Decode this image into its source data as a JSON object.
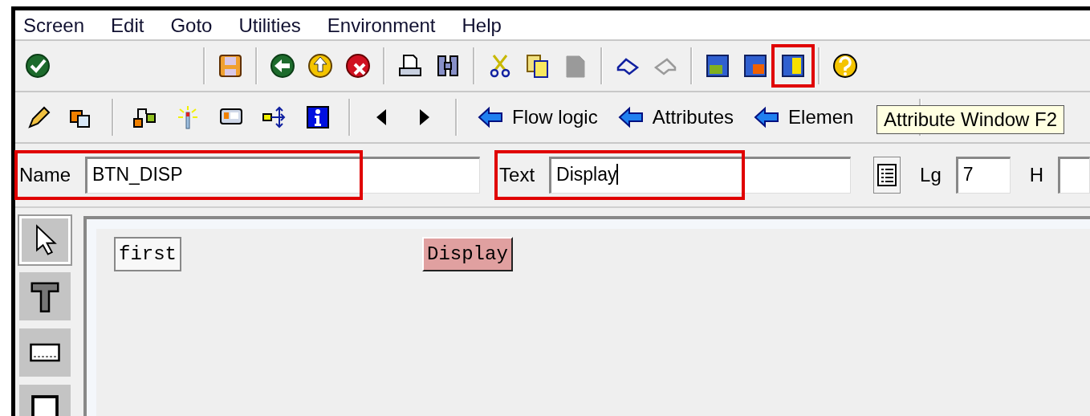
{
  "menu_bar": [
    "Screen",
    "Edit",
    "Goto",
    "Utilities",
    "Environment",
    "Help"
  ],
  "toolbar": [
    {
      "kind": "check"
    },
    {
      "kind": "gap"
    },
    {
      "kind": "separator"
    },
    {
      "kind": "save"
    },
    {
      "kind": "separator"
    },
    {
      "kind": "back"
    },
    {
      "kind": "exit"
    },
    {
      "kind": "cancel"
    },
    {
      "kind": "separator"
    },
    {
      "kind": "print"
    },
    {
      "kind": "find"
    },
    {
      "kind": "separator"
    },
    {
      "kind": "cut"
    },
    {
      "kind": "copy"
    },
    {
      "kind": "paste",
      "disabled": true
    },
    {
      "kind": "separator"
    },
    {
      "kind": "undo"
    },
    {
      "kind": "redo",
      "disabled": true
    },
    {
      "kind": "separator"
    },
    {
      "kind": "screen-a"
    },
    {
      "kind": "screen-b"
    },
    {
      "kind": "screen-c",
      "highlighted": true
    },
    {
      "kind": "separator"
    },
    {
      "kind": "help"
    }
  ],
  "app_toolbar": [
    {
      "kind": "pencil"
    },
    {
      "kind": "copy-object"
    },
    {
      "kind": "separator"
    },
    {
      "kind": "hierarchy"
    },
    {
      "kind": "wand"
    },
    {
      "kind": "layout"
    },
    {
      "kind": "distribute"
    },
    {
      "kind": "info"
    },
    {
      "kind": "separator"
    },
    {
      "kind": "left"
    },
    {
      "kind": "right"
    },
    {
      "kind": "separator"
    },
    {
      "kind": "link",
      "label": "Flow logic"
    },
    {
      "kind": "link",
      "label": "Attributes"
    },
    {
      "kind": "link",
      "label": "Elemen"
    }
  ],
  "tooltip": "Attribute Window F2",
  "fields": {
    "name": {
      "label": "Name",
      "value": "BTN_DISP",
      "highlighted": true
    },
    "text": {
      "label": "Text",
      "value": "Display",
      "highlighted": true
    },
    "lg": {
      "label": "Lg",
      "value": "7"
    },
    "h": {
      "label": "H"
    }
  },
  "palette": [
    {
      "kind": "pointer",
      "selected": true
    },
    {
      "kind": "text",
      "selected": false
    },
    {
      "kind": "input",
      "selected": false
    },
    {
      "kind": "checkbox",
      "selected": false
    }
  ],
  "screen_elements": [
    {
      "kind": "text",
      "label": "first",
      "selected": false
    },
    {
      "kind": "pushbutton",
      "label": "Display",
      "selected": true
    }
  ]
}
